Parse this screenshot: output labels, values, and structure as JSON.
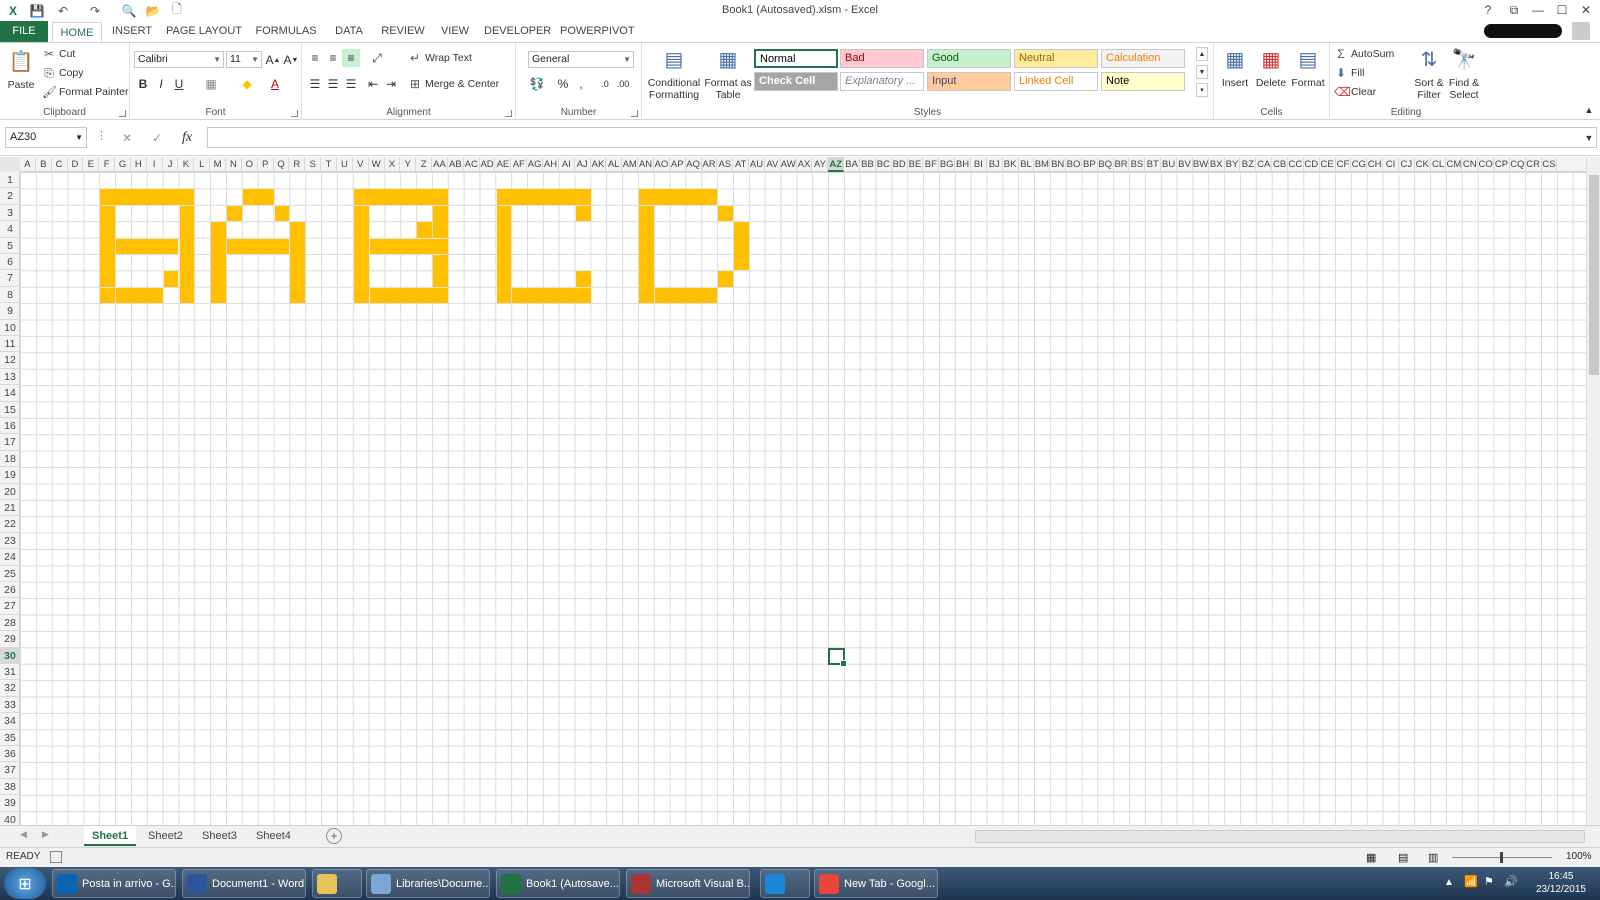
{
  "window": {
    "title": "Book1 (Autosaved).xlsm - Excel",
    "help": "?",
    "restore": "⧉",
    "minimize": "—",
    "maximize": "☐",
    "close": "✕"
  },
  "ribbon_tabs": [
    "FILE",
    "HOME",
    "INSERT",
    "PAGE LAYOUT",
    "FORMULAS",
    "DATA",
    "REVIEW",
    "VIEW",
    "DEVELOPER",
    "POWERPIVOT"
  ],
  "clipboard": {
    "paste": "Paste",
    "cut": "Cut",
    "copy": "Copy",
    "format_painter": "Format Painter",
    "label": "Clipboard"
  },
  "font": {
    "name": "Calibri",
    "size": "11",
    "label": "Font",
    "bold": "B",
    "italic": "I",
    "underline": "U"
  },
  "alignment": {
    "wrap": "Wrap Text",
    "merge": "Merge & Center",
    "label": "Alignment"
  },
  "number": {
    "format": "General",
    "percent": "%",
    "comma": ",",
    "label": "Number"
  },
  "styles": {
    "conditional": "Conditional Formatting",
    "format_table": "Format as Table",
    "label": "Styles",
    "cells": [
      {
        "name": "Normal",
        "bg": "#ffffff",
        "fg": "#000000"
      },
      {
        "name": "Bad",
        "bg": "#ffc7ce",
        "fg": "#9c0006"
      },
      {
        "name": "Good",
        "bg": "#c6efce",
        "fg": "#006100"
      },
      {
        "name": "Neutral",
        "bg": "#ffeb9c",
        "fg": "#9c6500"
      },
      {
        "name": "Calculation",
        "bg": "#f2f2f2",
        "fg": "#fa7d00"
      },
      {
        "name": "Check Cell",
        "bg": "#a5a5a5",
        "fg": "#ffffff"
      },
      {
        "name": "Explanatory ...",
        "bg": "#ffffff",
        "fg": "#7f7f7f"
      },
      {
        "name": "Input",
        "bg": "#ffcc99",
        "fg": "#3f3f76"
      },
      {
        "name": "Linked Cell",
        "bg": "#ffffff",
        "fg": "#fa7d00"
      },
      {
        "name": "Note",
        "bg": "#ffffcc",
        "fg": "#000000"
      }
    ]
  },
  "cells_group": {
    "insert": "Insert",
    "delete": "Delete",
    "format": "Format",
    "label": "Cells"
  },
  "editing": {
    "autosum": "AutoSum",
    "fill": "Fill",
    "clear": "Clear",
    "sort": "Sort & Filter",
    "find": "Find & Select",
    "label": "Editing"
  },
  "formula_bar": {
    "name_box": "AZ30",
    "fx": "fx",
    "value": ""
  },
  "columns": [
    "A",
    "B",
    "C",
    "D",
    "E",
    "F",
    "G",
    "H",
    "I",
    "J",
    "K",
    "L",
    "M",
    "N",
    "O",
    "P",
    "Q",
    "R",
    "S",
    "T",
    "U",
    "V",
    "W",
    "X",
    "Y",
    "Z",
    "AA",
    "AB",
    "AC",
    "AD",
    "AE",
    "AF",
    "AG",
    "AH",
    "AI",
    "AJ",
    "AK",
    "AL",
    "AM",
    "AN",
    "AO",
    "AP",
    "AQ",
    "AR",
    "AS",
    "AT",
    "AU",
    "AV",
    "AW",
    "AX",
    "AY",
    "AZ",
    "BA",
    "BB",
    "BC",
    "BD",
    "BE",
    "BF",
    "BG",
    "BH",
    "BI",
    "BJ",
    "BK",
    "BL",
    "BM",
    "BN",
    "BO",
    "BP",
    "BQ",
    "BR",
    "BS",
    "BT",
    "BU",
    "BV",
    "BW",
    "BX",
    "BY",
    "BZ",
    "CA",
    "CB",
    "CC",
    "CD",
    "CE",
    "CF",
    "CG",
    "CH",
    "CI",
    "CJ",
    "CK",
    "CL",
    "CM",
    "CN",
    "CO",
    "CP",
    "CQ",
    "CR",
    "CS"
  ],
  "selected_column": "AZ",
  "selected_row": 30,
  "rows": 40,
  "fill_color": "#ffc000",
  "sheets": [
    "Sheet1",
    "Sheet2",
    "Sheet3",
    "Sheet4"
  ],
  "active_sheet": "Sheet1",
  "status": {
    "mode": "READY",
    "zoom": "100%"
  },
  "taskbar": [
    {
      "label": "Posta in arrivo - G...",
      "icon": "outlook-icon",
      "color": "#0a64b4"
    },
    {
      "label": "Document1 - Word",
      "icon": "word-icon",
      "color": "#2b579a"
    },
    {
      "label": "",
      "icon": "explorer-icon",
      "color": "#e8c35a"
    },
    {
      "label": "Libraries\\Docume...",
      "icon": "folder-icon",
      "color": "#7aa7d8"
    },
    {
      "label": "Book1 (Autosave...",
      "icon": "excel-icon",
      "color": "#217346"
    },
    {
      "label": "Microsoft Visual B...",
      "icon": "vba-icon",
      "color": "#a33"
    },
    {
      "label": "",
      "icon": "ie-icon",
      "color": "#1b88d6"
    },
    {
      "label": "New Tab - Googl...",
      "icon": "chrome-icon",
      "color": "#e8453c"
    }
  ],
  "clock": {
    "time": "16:45",
    "date": "23/12/2015"
  }
}
